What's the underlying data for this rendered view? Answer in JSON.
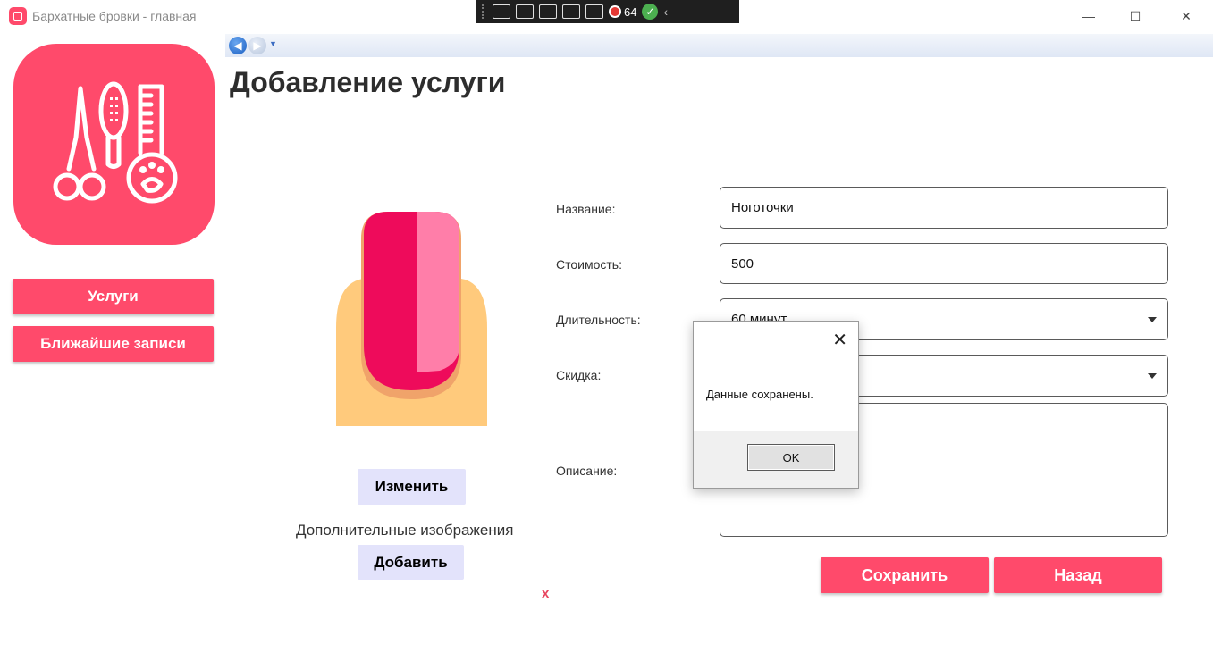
{
  "window": {
    "title": "Бархатные бровки - главная",
    "minimize_glyph": "—",
    "maximize_glyph": "☐",
    "close_glyph": "✕"
  },
  "debug_toolbar": {
    "fps": "64"
  },
  "sidebar": {
    "items": [
      {
        "label": "Услуги"
      },
      {
        "label": "Ближайшие записи"
      }
    ]
  },
  "page": {
    "title": "Добавление услуги",
    "change_image_label": "Изменить",
    "extra_images_label": "Дополнительные изображения",
    "add_image_label": "Добавить",
    "remove_label": "x"
  },
  "form": {
    "name_label": "Название:",
    "name_value": "Ноготочки",
    "cost_label": "Стоимость:",
    "cost_value": "500",
    "duration_label": "Длительность:",
    "duration_value": "60 минут",
    "discount_label": "Скидка:",
    "discount_value": "",
    "description_label": "Описание:",
    "description_value": ""
  },
  "actions": {
    "save_label": "Сохранить",
    "back_label": "Назад"
  },
  "dialog": {
    "message": "Данные сохранены.",
    "ok_label": "OK",
    "close_glyph": "✕"
  },
  "colors": {
    "accent": "#ff4a6b",
    "light_button": "#e3e3fb"
  }
}
